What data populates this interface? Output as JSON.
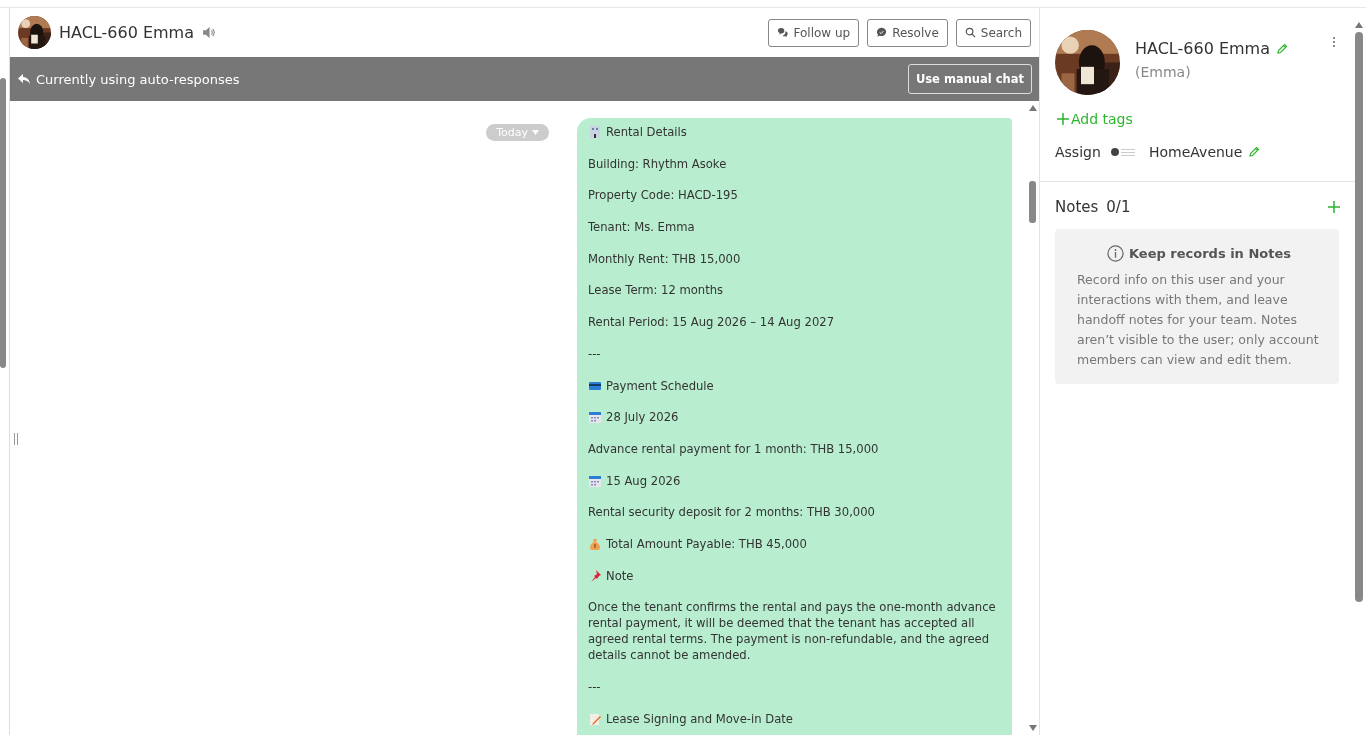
{
  "chat_header": {
    "title": "HACL-660 Emma",
    "buttons": [
      {
        "kind": "follow",
        "label": "Follow up"
      },
      {
        "kind": "resolve",
        "label": "Resolve"
      },
      {
        "kind": "search",
        "label": "Search"
      }
    ]
  },
  "auto_bar": {
    "text": "Currently using auto-responses",
    "button": "Use manual chat"
  },
  "date_pill": "Today",
  "message": {
    "lines": [
      {
        "kind": "building",
        "text": "Rental Details"
      },
      {
        "kind": "text",
        "text": "Building: Rhythm Asoke"
      },
      {
        "kind": "text",
        "text": "Property Code: HACD-195"
      },
      {
        "kind": "text",
        "text": "Tenant: Ms. Emma"
      },
      {
        "kind": "text",
        "text": "Monthly Rent: THB 15,000"
      },
      {
        "kind": "text",
        "text": "Lease Term: 12 months"
      },
      {
        "kind": "text",
        "text": "Rental Period: 15 Aug 2026 – 14 Aug 2027"
      },
      {
        "kind": "text",
        "text": "---"
      },
      {
        "kind": "card",
        "text": "Payment Schedule"
      },
      {
        "kind": "calendar",
        "text": "28 July 2026"
      },
      {
        "kind": "text",
        "text": "Advance rental payment for 1 month: THB 15,000"
      },
      {
        "kind": "calendar",
        "text": "15 Aug 2026"
      },
      {
        "kind": "text",
        "text": "Rental security deposit for 2 months: THB 30,000"
      },
      {
        "kind": "bag",
        "text": "Total Amount Payable: THB 45,000"
      },
      {
        "kind": "pin",
        "text": "Note"
      },
      {
        "kind": "text",
        "text": "Once the tenant confirms the rental and pays the one-month advance rental payment, it will be deemed that the tenant has accepted all agreed rental terms. The payment is non-refundable, and the agreed details cannot be amended."
      },
      {
        "kind": "text",
        "text": "---"
      },
      {
        "kind": "memo",
        "text": "Lease Signing and Move-in Date"
      }
    ]
  },
  "profile": {
    "name": "HACL-660 Emma",
    "nickname": "(Emma)",
    "add_tags": "Add tags",
    "assign_label": "Assign",
    "assignee": "HomeAvenue"
  },
  "notes": {
    "title": "Notes",
    "count": "0/1",
    "tip_title": "Keep records in Notes",
    "tip_text": "Record info on this user and your interactions with them, and leave handoff notes for your team. Notes aren’t visible to the user; only account members can view and edit them."
  }
}
